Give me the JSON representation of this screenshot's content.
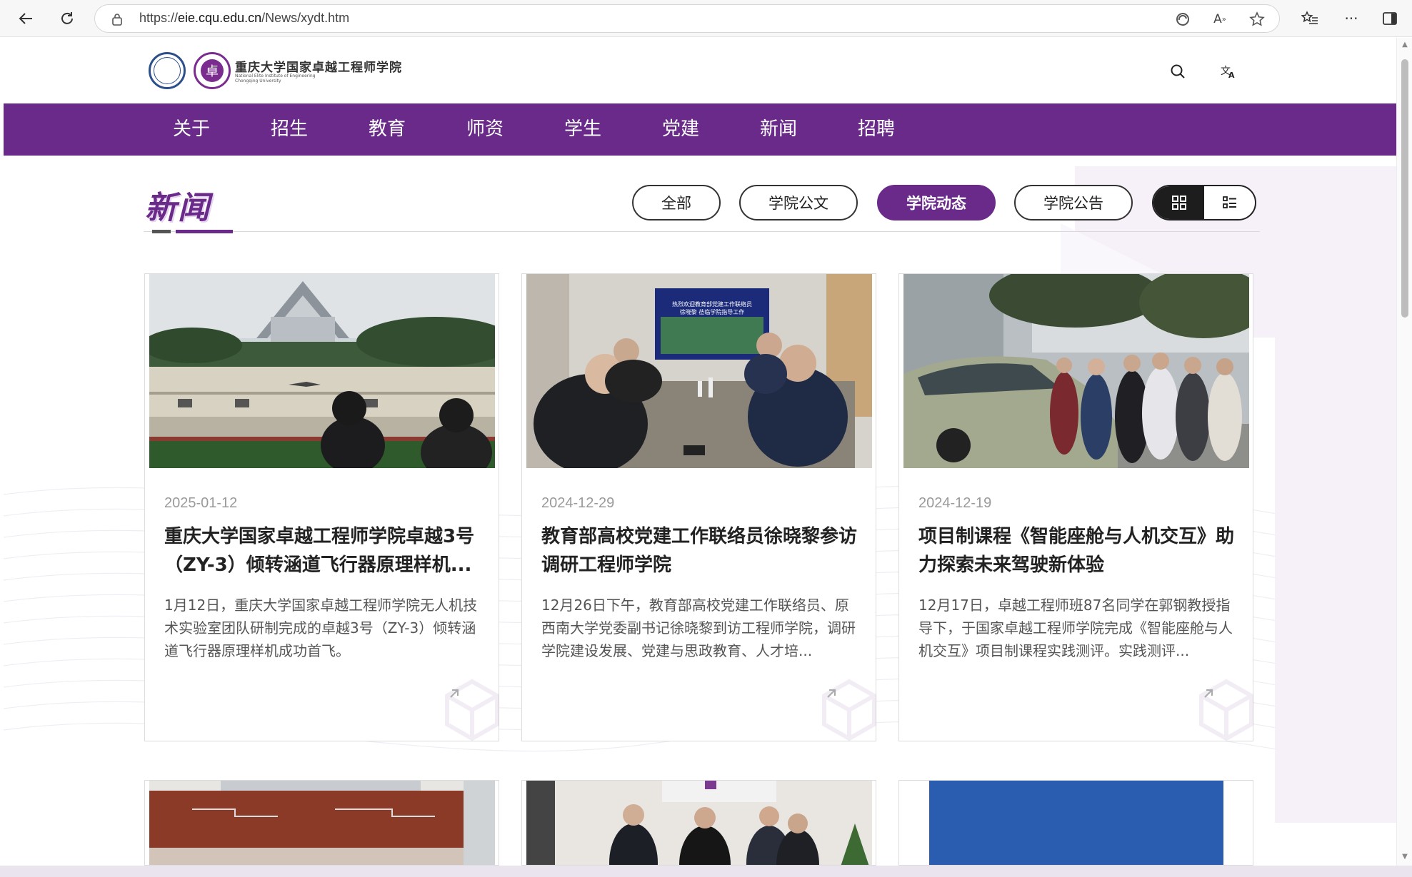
{
  "browser": {
    "url_prefix": "https://",
    "url_host": "eie.cqu.edu.cn",
    "url_path": "/News/xydt.htm",
    "buttons": [
      "back-icon",
      "refresh-icon",
      "lock-icon",
      "edge-shield-icon",
      "read-aloud-icon",
      "favorite-star-icon",
      "favorites-list-icon",
      "more-icon",
      "sidebar-icon"
    ]
  },
  "header": {
    "brand_cn": "重庆大学国家卓越工程师学院",
    "brand_en_line1": "National Elite Institute of Engineering",
    "brand_en_line2": "Chongqing University",
    "logo2_glyph": "卓"
  },
  "nav": {
    "items": [
      "关于",
      "招生",
      "教育",
      "师资",
      "学生",
      "党建",
      "新闻",
      "招聘"
    ]
  },
  "section": {
    "title": "新闻",
    "filters": [
      "全部",
      "学院公文",
      "学院动态",
      "学院公告"
    ],
    "active_filter": "学院动态"
  },
  "cards": [
    {
      "date": "2025-01-12",
      "title": "重庆大学国家卓越工程师学院卓越3号（ZY-3）倾转涵道飞行器原理样机...",
      "summary": "1月12日，重庆大学国家卓越工程师学院无人机技术实验室团队研制完成的卓越3号（ZY-3）倾转涵道飞行器原理样机成功首飞。"
    },
    {
      "date": "2024-12-29",
      "title": "教育部高校党建工作联络员徐晓黎参访调研工程师学院",
      "summary": "12月26日下午，教育部高校党建工作联络员、原西南大学党委副书记徐晓黎到访工程师学院，调研学院建设发展、党建与思政教育、人才培..."
    },
    {
      "date": "2024-12-19",
      "title": "项目制课程《智能座舱与人机交互》助力探索未来驾驶新体验",
      "summary": "12月17日，卓越工程师班87名同学在郭钢教授指导下，于国家卓越工程师学院完成《智能座舱与人机交互》项目制课程实践测评。实践测评..."
    }
  ],
  "screen_text": {
    "screen_line1": "热烈欢迎教育部党建工作联络员",
    "screen_line2": "徐晓黎 莅临学院指导工作"
  },
  "colors": {
    "brand_purple": "#6a2a8a",
    "nav_text": "#ffffff",
    "date_gray": "#9a9a9a"
  }
}
